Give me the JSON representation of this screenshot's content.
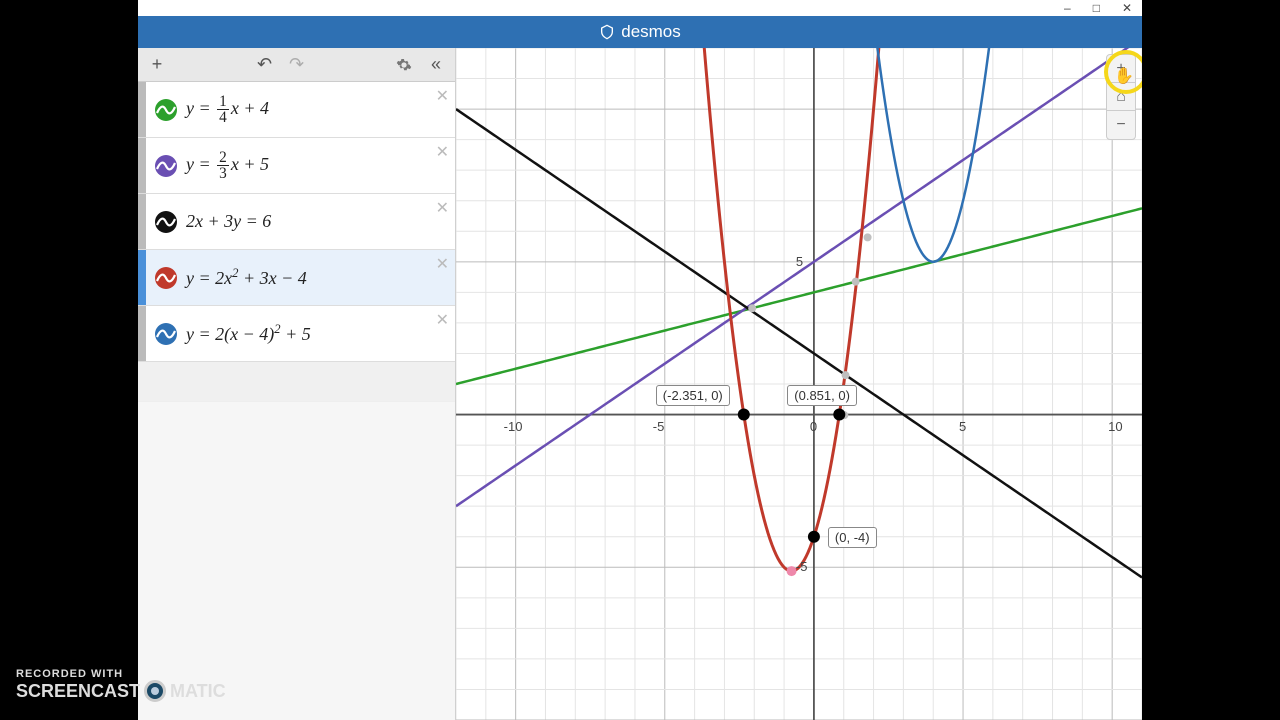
{
  "window": {
    "minimize": "–",
    "maximize": "□",
    "close": "✕"
  },
  "titlebar": {
    "brand": "desmos"
  },
  "toolbar": {
    "add": "+",
    "undo": "↶",
    "redo": "↷",
    "settings": "⚙",
    "collapse": "«"
  },
  "graph": {
    "x_range": [
      -12,
      11
    ],
    "y_range": [
      -10,
      12
    ],
    "x_ticks": [
      -10,
      -5,
      0,
      5,
      10
    ],
    "y_ticks": [
      -5,
      5
    ]
  },
  "expressions": [
    {
      "id": 1,
      "color": "#2ca02c",
      "latex_html": "<i>y</i> = <span class='frac'><span class='num'>1</span><span class='den'>4</span></span><i>x</i> + 4",
      "selected": false
    },
    {
      "id": 2,
      "color": "#6a4fb3",
      "latex_html": "<i>y</i> = <span class='frac'><span class='num'>2</span><span class='den'>3</span></span><i>x</i> + 5",
      "selected": false
    },
    {
      "id": 3,
      "color": "#111111",
      "latex_html": "2<i>x</i> + 3<i>y</i> = 6",
      "selected": false
    },
    {
      "id": 4,
      "color": "#c0392b",
      "latex_html": "<i>y</i> = 2<i>x</i><sup>2</sup> + 3<i>x</i> − 4",
      "selected": true
    },
    {
      "id": 5,
      "color": "#2e70b3",
      "latex_html": "<i>y</i> = 2(<i>x</i> − 4)<sup>2</sup> + 5",
      "selected": false
    }
  ],
  "points": [
    {
      "x": -2.351,
      "y": 0,
      "label": "(-2.351, 0)",
      "label_dx": -88,
      "label_dy": -30
    },
    {
      "x": 0.851,
      "y": 0,
      "label": "(0.851, 0)",
      "label_dx": -52,
      "label_dy": -30
    },
    {
      "x": 0,
      "y": -4,
      "label": "(0, -4)",
      "label_dx": 14,
      "label_dy": -10
    }
  ],
  "zoom": {
    "in": "+",
    "home": "⌂",
    "out": "−"
  },
  "chart_data": {
    "type": "line",
    "title": "",
    "xlabel": "",
    "ylabel": "",
    "xlim": [
      -12,
      11
    ],
    "ylim": [
      -10,
      12
    ],
    "grid": true,
    "series": [
      {
        "name": "y = (1/4)x + 4",
        "color": "#2ca02c",
        "type": "line",
        "fn": "0.25*x + 4"
      },
      {
        "name": "y = (2/3)x + 5",
        "color": "#6a4fb3",
        "type": "line",
        "fn": "(2/3)*x + 5"
      },
      {
        "name": "2x + 3y = 6",
        "color": "#111111",
        "type": "line",
        "fn": "(6 - 2*x)/3"
      },
      {
        "name": "y = 2x^2 + 3x - 4",
        "color": "#c0392b",
        "type": "parabola",
        "a": 2,
        "b": 3,
        "c": -4
      },
      {
        "name": "y = 2(x-4)^2 + 5",
        "color": "#2e70b3",
        "type": "parabola",
        "a": 2,
        "h": 4,
        "k": 5
      }
    ],
    "annotations": [
      "(-2.351, 0)",
      "(0.851, 0)",
      "(0, -4)"
    ]
  },
  "watermark": {
    "line1": "RECORDED WITH",
    "line2a": "SCREENCAST",
    "line2b": "MATIC"
  }
}
